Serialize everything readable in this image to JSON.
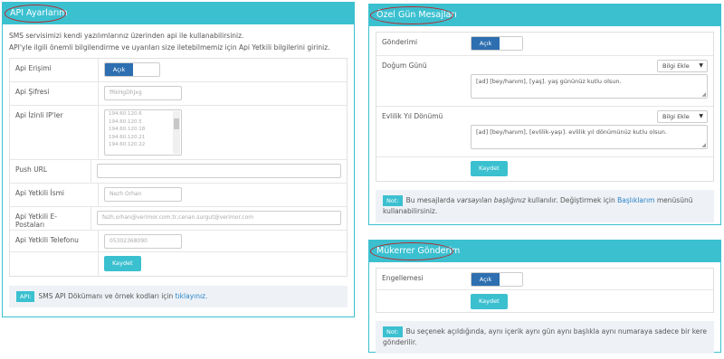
{
  "api": {
    "title": "API Ayarlarım",
    "intro1": "SMS servisimizi kendi yazılımlarınız üzerinden api ile kullanabilirsiniz.",
    "intro2": "API'yle ilgili önemli bilgilendirme ve uyarıları size iletebilmemiz için Api Yetkili bilgilerini giriniz.",
    "access_label": "Api Erişimi",
    "access_toggle": "Açık",
    "password_label": "Api Şifresi",
    "password_value": "fRkHgDhJxg",
    "ips_label": "Api İzinli IP'ler",
    "ips": [
      "194.60.120.6",
      "194.60.120.5",
      "194.60.120.18",
      "194.60.120.21",
      "194.60.120.22"
    ],
    "push_label": "Push URL",
    "push_value": "",
    "name_label": "Api Yetkili İsmi",
    "name_value": "Nezh Orhan",
    "email_label": "Api Yetkili E-Postaları",
    "email_value": "fezh.orhan@verimor.com.tr,cenan.surgut@verimor.com",
    "phone_label": "Api Yetkili Telefonu",
    "phone_value": "05302368090",
    "save": "Kaydet",
    "note_tag": "API:",
    "note_text": "SMS API Dökümanı ve örnek kodları için",
    "note_link": "tıklayınız."
  },
  "special": {
    "title": "Özel Gün Mesajları",
    "send_label": "Gönderimi",
    "send_toggle": "Açık",
    "birthday_label": "Doğum Günü",
    "birthday_select": "Bilgi Ekle",
    "birthday_text": "[ad] [bey/hanım], [yaş]. yaş gününüz kutlu olsun.",
    "anniv_label": "Evlilik Yıl Dönümü",
    "anniv_select": "Bilgi Ekle",
    "anniv_text": "[ad] [bey/hanım], [evlilik-yaşı]. evlilik yıl dönümünüz kutlu olsun.",
    "save": "Kaydet",
    "note_tag": "Not:",
    "note_text1": "Bu mesajlarda",
    "note_italic": "varsayılan başlığınız",
    "note_text2": "kullanılır. Değiştirmek için",
    "note_link": "Başlıklarım",
    "note_text3": "menüsünü kullanabilirsiniz."
  },
  "repeat": {
    "title": "Mükerrer Gönderim",
    "block_label": "Engellemesi",
    "block_toggle": "Açık",
    "save": "Kaydet",
    "note_tag": "Not:",
    "note_text": "Bu seçenek açıldığında, aynı içerik aynı gün aynı başlıkla aynı numaraya sadece bir kere gönderilir."
  }
}
